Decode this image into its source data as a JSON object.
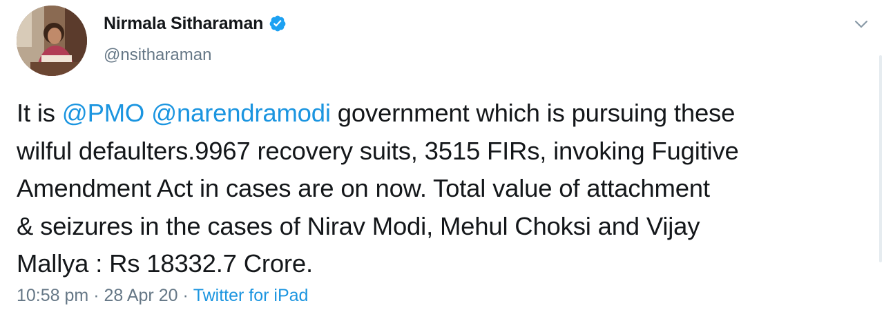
{
  "author": {
    "display_name": "Nirmala Sitharaman",
    "handle": "@nsitharaman",
    "verified": true,
    "avatar_icon": "profile-photo"
  },
  "tweet": {
    "segments": [
      {
        "text": "It is ",
        "type": "text"
      },
      {
        "text": "@PMO",
        "type": "mention"
      },
      {
        "text": " ",
        "type": "text"
      },
      {
        "text": "@narendramodi",
        "type": "mention"
      },
      {
        "text": " government which is pursuing these",
        "type": "text"
      }
    ],
    "lines": [
      "wilful defaulters.9967 recovery suits, 3515 FIRs, invoking Fugitive",
      "Amendment Act in cases are on now. Total value of attachment",
      "& seizures in the cases of Nirav Modi, Mehul Choksi and Vijay",
      "Mallya : Rs 18332.7 Crore."
    ]
  },
  "meta": {
    "time": "10:58 pm",
    "separator_1": " · ",
    "date": "28 Apr 20",
    "separator_2": " · ",
    "source": "Twitter for iPad"
  },
  "colors": {
    "link": "#1b95e0",
    "text": "#14171a",
    "muted": "#657786",
    "verified": "#1da1f2"
  },
  "icons": {
    "verified": "verified-badge-icon",
    "menu": "chevron-down-icon"
  }
}
